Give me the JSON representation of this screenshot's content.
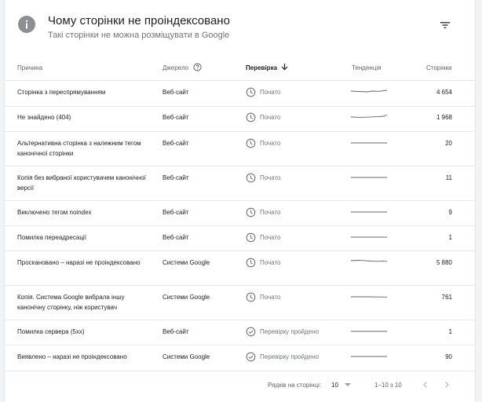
{
  "header": {
    "title": "Чому сторінки не проіндексовано",
    "subtitle": "Такі сторінки не можна розміщувати в Google"
  },
  "columns": {
    "reason": "Причина",
    "source": "Джерело",
    "validation": "Перевірка",
    "trend": "Тенденція",
    "pages": "Сторінки"
  },
  "rows": [
    {
      "reason": "Сторінка з переспрямуванням",
      "source": "Веб-сайт",
      "status": "Почато",
      "status_icon": "clock-icon",
      "pages": "4 654"
    },
    {
      "reason": "Не знайдено (404)",
      "source": "Веб-сайт",
      "status": "Почато",
      "status_icon": "clock-icon",
      "pages": "1 968"
    },
    {
      "reason": "Альтернативна сторінка з належним тегом канонічної сторінки",
      "source": "Веб-сайт",
      "status": "Почато",
      "status_icon": "clock-icon",
      "pages": "20"
    },
    {
      "reason": "Копія без вибраної користувачем канонічної версії",
      "source": "Веб-сайт",
      "status": "Почато",
      "status_icon": "clock-icon",
      "pages": "11"
    },
    {
      "reason": "Виключено тегом noindex",
      "source": "Веб-сайт",
      "status": "Почато",
      "status_icon": "clock-icon",
      "pages": "9"
    },
    {
      "reason": "Помилка переадресації",
      "source": "Веб-сайт",
      "status": "Почато",
      "status_icon": "clock-icon",
      "pages": "1"
    },
    {
      "reason": "Проскановано – наразі не проіндексовано",
      "source": "Системи Google",
      "status": "Почато",
      "status_icon": "clock-icon",
      "pages": "5 880"
    },
    {
      "reason": "Копія. Система Google вибрала іншу канонічну сторінку, ніж користувач",
      "source": "Системи Google",
      "status": "Почато",
      "status_icon": "clock-icon",
      "pages": "761"
    },
    {
      "reason": "Помилка сервера (5xx)",
      "source": "Веб-сайт",
      "status": "Перевірку пройдено",
      "status_icon": "check-circle-icon",
      "pages": "1"
    },
    {
      "reason": "Виявлено – наразі не проіндексовано",
      "source": "Системи Google",
      "status": "Перевірку пройдено",
      "status_icon": "check-circle-icon",
      "pages": "90"
    }
  ],
  "footer": {
    "rows_per_page_label": "Рядків на сторінці:",
    "rows_per_page_value": "10",
    "range": "1–10 з 10"
  },
  "colors": {
    "icon_grey": "#8c8f94",
    "text_secondary": "#70757a",
    "divider": "#e6e7e9"
  }
}
